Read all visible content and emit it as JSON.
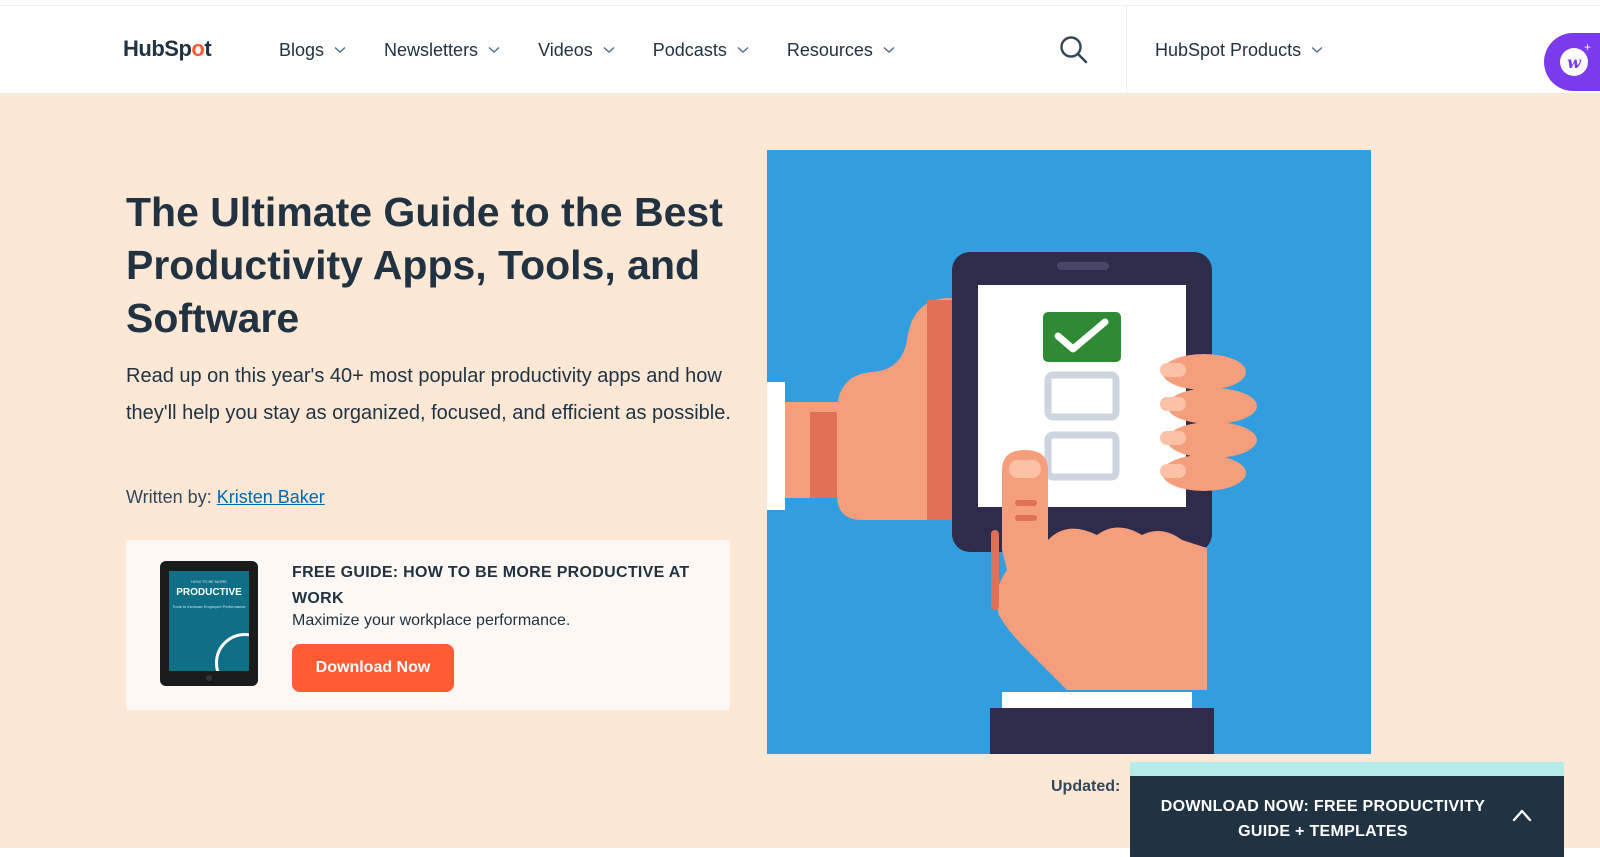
{
  "header": {
    "logo": {
      "text_before": "HubSp",
      "text_dot": "o",
      "text_after": "t"
    },
    "nav": [
      {
        "label": "Blogs"
      },
      {
        "label": "Newsletters"
      },
      {
        "label": "Videos"
      },
      {
        "label": "Podcasts"
      },
      {
        "label": "Resources"
      }
    ],
    "search_icon": "search-icon",
    "products_label": "HubSpot Products",
    "assistant_icon": "assistant-w-icon",
    "assistant_glyph": "w",
    "assistant_sparkle": "+"
  },
  "hero": {
    "title": "The Ultimate Guide to the Best Productivity Apps, Tools, and Software",
    "description": "Read up on this year's 40+ most popular productivity apps and how they'll help you stay as organized, focused, and efficient as possible.",
    "author_label": "Written by:",
    "author_name": "Kristen Baker",
    "updated_label": "Updated:",
    "illustration_alt": "hands-holding-phone-checklist",
    "colors": {
      "background": "#fce8d5",
      "illustration_bg": "#329ee0",
      "accent": "#ff5c35"
    }
  },
  "promo": {
    "cover": {
      "small": "HOW TO BE MORE",
      "big": "PRODUCTIVE",
      "sub": "Tools to Increase Employee Performance"
    },
    "title": "FREE GUIDE: HOW TO BE MORE PRODUCTIVE AT WORK",
    "subtitle": "Maximize your workplace performance.",
    "button_label": "Download Now"
  },
  "sticky_cta": {
    "text": "DOWNLOAD NOW: FREE PRODUCTIVITY GUIDE + TEMPLATES",
    "icon": "chevron-up-icon"
  }
}
